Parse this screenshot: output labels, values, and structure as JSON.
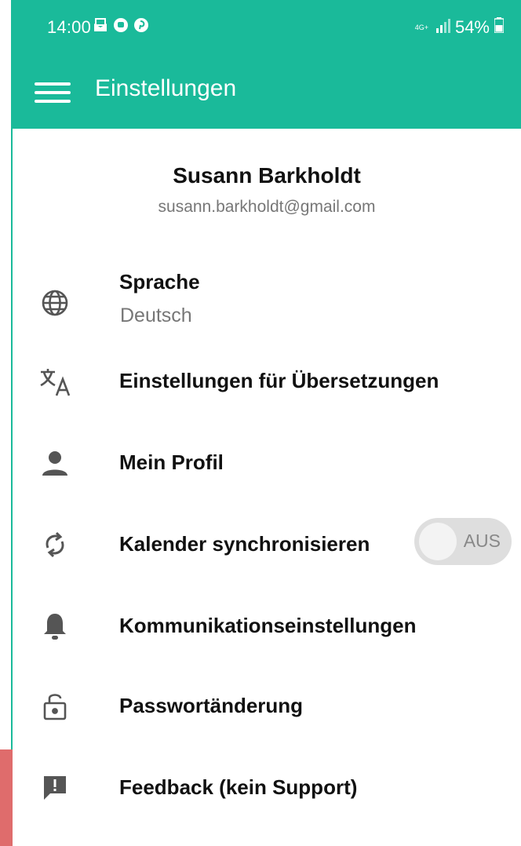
{
  "status_bar": {
    "time": "14:00",
    "network": "4G+",
    "battery": "54%",
    "notification_icons": [
      "mail-icon",
      "chat-icon",
      "pinterest-icon"
    ]
  },
  "app_bar": {
    "title": "Einstellungen",
    "menu_icon": "hamburger-icon"
  },
  "profile": {
    "name": "Susann Barkholdt",
    "email": "susann.barkholdt@gmail.com"
  },
  "settings": {
    "language": {
      "label": "Sprache",
      "value": "Deutsch",
      "icon": "globe-icon"
    },
    "translation": {
      "label": "Einstellungen für Übersetzungen",
      "icon": "translate-icon"
    },
    "profile": {
      "label": "Mein Profil",
      "icon": "person-icon"
    },
    "calendar": {
      "label": "Kalender synchronisieren",
      "icon": "sync-icon",
      "toggle_text": "AUS",
      "toggle_on": false
    },
    "communication": {
      "label": "Kommunikationseinstellungen",
      "icon": "bell-icon"
    },
    "password": {
      "label": "Passwortänderung",
      "icon": "lock-icon"
    },
    "feedback": {
      "label": "Feedback (kein Support)",
      "icon": "feedback-icon"
    }
  },
  "colors": {
    "primary": "#1aba9a",
    "accent_edge": "#df6c6c",
    "text_primary": "#111111",
    "text_secondary": "#777777"
  }
}
